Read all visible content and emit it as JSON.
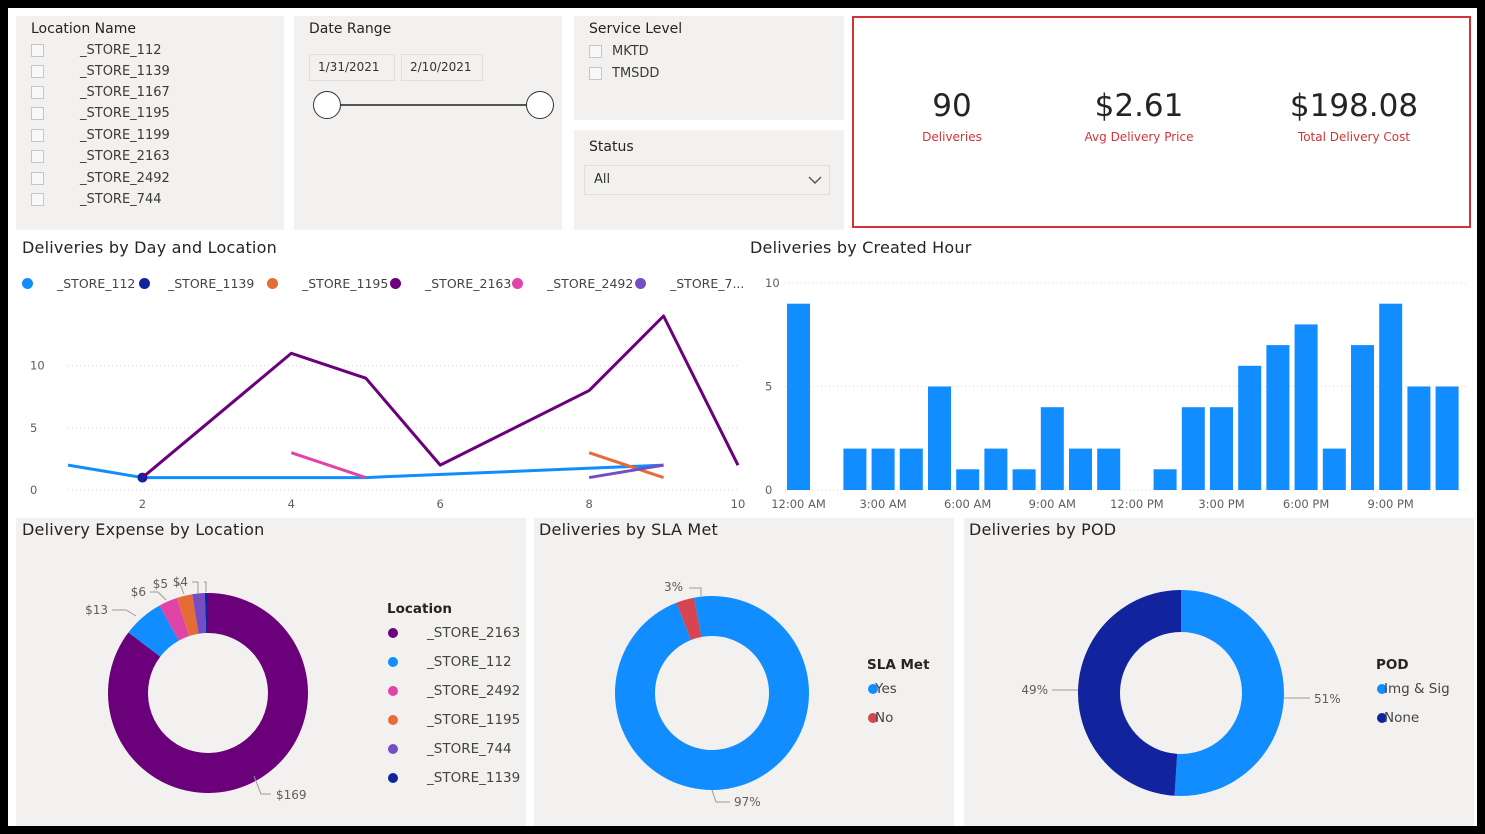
{
  "filters": {
    "location": {
      "title": "Location Name",
      "items": [
        "_STORE_112",
        "_STORE_1139",
        "_STORE_1167",
        "_STORE_1195",
        "_STORE_1199",
        "_STORE_2163",
        "_STORE_2492",
        "_STORE_744"
      ]
    },
    "date_range": {
      "title": "Date Range",
      "start": "1/31/2021",
      "end": "2/10/2021"
    },
    "service_level": {
      "title": "Service Level",
      "items": [
        "MKTD",
        "TMSDD"
      ]
    },
    "status": {
      "title": "Status",
      "selected": "All",
      "chevron_icon": "chevron-down-icon"
    }
  },
  "kpis": [
    {
      "value": "90",
      "label": "Deliveries"
    },
    {
      "value": "$2.61",
      "label": "Avg Delivery Price"
    },
    {
      "value": "$198.08",
      "label": "Total Delivery Cost"
    }
  ],
  "colors": {
    "kpi_label": "#d13438",
    "kpi_border": "#d13438",
    "store_112": "#118dff",
    "store_1139": "#12239e",
    "store_1195": "#e66c37",
    "store_2163": "#6b007b",
    "store_2492": "#e044a7",
    "store_744": "#744ec2",
    "bar": "#118dff",
    "sla_yes": "#118dff",
    "sla_no": "#d64550",
    "pod_img": "#118dff",
    "pod_none": "#12239e"
  },
  "chart_titles": {
    "line": "Deliveries by Day and Location",
    "bar": "Deliveries by Created Hour",
    "expense": "Delivery Expense by Location",
    "sla": "Deliveries by SLA Met",
    "pod": "Deliveries by POD"
  },
  "chart_data": [
    {
      "type": "line",
      "title": "Deliveries by Day and Location",
      "legend": [
        "_STORE_112",
        "_STORE_1139",
        "_STORE_1195",
        "_STORE_2163",
        "_STORE_2492",
        "_STORE_7..."
      ],
      "x_ticks": [
        "2",
        "4",
        "6",
        "8",
        "10"
      ],
      "y_ticks": [
        "0",
        "5",
        "10"
      ],
      "xlim": [
        1,
        10
      ],
      "ylim": [
        0,
        14
      ],
      "grid": true,
      "series": [
        {
          "name": "_STORE_112",
          "points": [
            [
              1,
              2
            ],
            [
              2,
              1
            ],
            [
              5,
              1
            ],
            [
              9,
              2
            ]
          ]
        },
        {
          "name": "_STORE_1139",
          "points": [
            [
              2,
              1
            ]
          ]
        },
        {
          "name": "_STORE_1195",
          "points": [
            [
              8,
              3
            ],
            [
              9,
              1
            ]
          ]
        },
        {
          "name": "_STORE_2163",
          "points": [
            [
              2,
              1
            ],
            [
              4,
              11
            ],
            [
              5,
              9
            ],
            [
              6,
              2
            ],
            [
              8,
              8
            ],
            [
              9,
              14
            ],
            [
              10,
              2
            ]
          ]
        },
        {
          "name": "_STORE_2492",
          "points": [
            [
              4,
              3
            ],
            [
              5,
              1
            ]
          ]
        },
        {
          "name": "_STORE_744",
          "points": [
            [
              8,
              1
            ],
            [
              9,
              2
            ]
          ]
        }
      ]
    },
    {
      "type": "bar",
      "title": "Deliveries by Created Hour",
      "x_ticks": [
        "12:00 AM",
        "3:00 AM",
        "6:00 AM",
        "9:00 AM",
        "12:00 PM",
        "3:00 PM",
        "6:00 PM",
        "9:00 PM"
      ],
      "y_ticks": [
        "0",
        "5",
        "10"
      ],
      "ylim": [
        0,
        10
      ],
      "grid": true,
      "values": [
        9,
        0,
        2,
        2,
        2,
        5,
        1,
        2,
        1,
        4,
        2,
        2,
        0,
        1,
        4,
        4,
        6,
        7,
        8,
        2,
        7,
        9,
        5,
        5
      ]
    },
    {
      "type": "pie",
      "title": "Delivery Expense by Location",
      "legend_title": "Location",
      "slices": [
        {
          "name": "_STORE_2163",
          "value": 169,
          "label": "$169"
        },
        {
          "name": "_STORE_112",
          "value": 13,
          "label": "$13"
        },
        {
          "name": "_STORE_2492",
          "value": 6,
          "label": "$6"
        },
        {
          "name": "_STORE_1195",
          "value": 5,
          "label": "$5"
        },
        {
          "name": "_STORE_744",
          "value": 4,
          "label": "$4"
        },
        {
          "name": "_STORE_1139",
          "value": 1,
          "label": "$1"
        }
      ]
    },
    {
      "type": "pie",
      "title": "Deliveries by SLA Met",
      "legend_title": "SLA Met",
      "slices": [
        {
          "name": "Yes",
          "value": 97,
          "label": "97%"
        },
        {
          "name": "No",
          "value": 3,
          "label": "3%"
        }
      ]
    },
    {
      "type": "pie",
      "title": "Deliveries by POD",
      "legend_title": "POD",
      "slices": [
        {
          "name": "Img & Sig",
          "value": 51,
          "label": "51%"
        },
        {
          "name": "None",
          "value": 49,
          "label": "49%"
        }
      ]
    }
  ]
}
